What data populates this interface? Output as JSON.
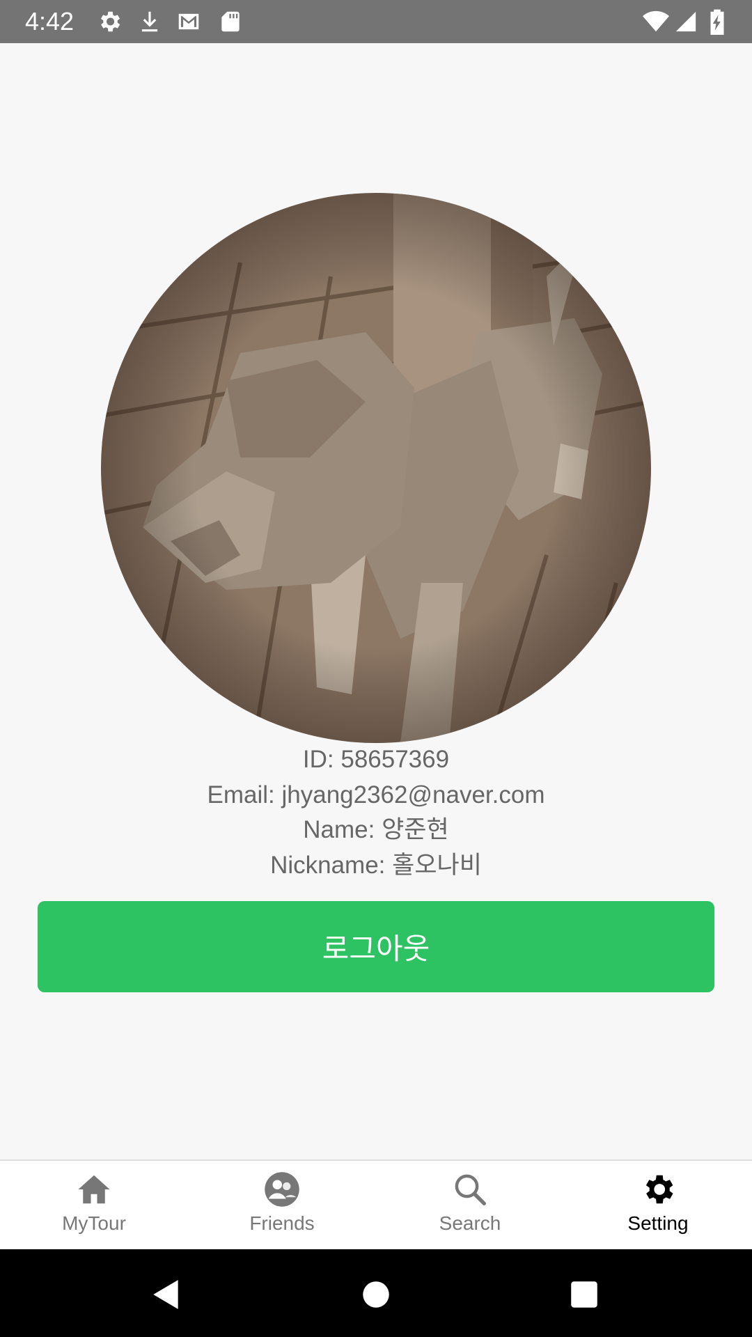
{
  "status_bar": {
    "time": "4:42",
    "icons": [
      "gear-icon",
      "download-icon",
      "gmail-icon",
      "sd-card-icon",
      "wifi-icon",
      "signal-icon",
      "battery-charging-icon"
    ]
  },
  "profile": {
    "avatar": "dog-photo",
    "id_line": "ID: 58657369",
    "email_line": "Email: jhyang2362@naver.com",
    "name_line": "Name: 양준현",
    "nickname_line": "Nickname: 홀오나비"
  },
  "logout_button": {
    "label": "로그아웃",
    "color": "#2dc262"
  },
  "bottom_nav": {
    "items": [
      {
        "label": "MyTour",
        "icon": "home-icon",
        "active": false
      },
      {
        "label": "Friends",
        "icon": "friends-icon",
        "active": false
      },
      {
        "label": "Search",
        "icon": "search-icon",
        "active": false
      },
      {
        "label": "Setting",
        "icon": "gear-icon",
        "active": true
      }
    ]
  },
  "system_nav": {
    "buttons": [
      "back-icon",
      "home-circle-icon",
      "recents-icon"
    ]
  }
}
